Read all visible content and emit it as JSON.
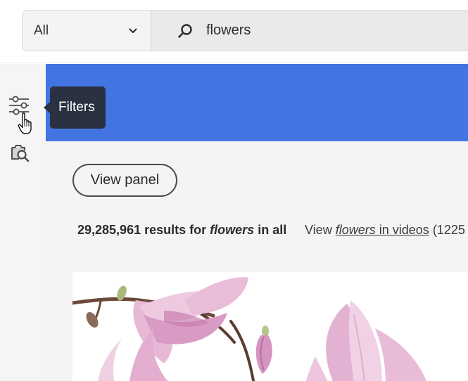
{
  "search": {
    "scope_value": "All",
    "query": "flowers"
  },
  "tooltip": {
    "label": "Filters"
  },
  "view_panel_button": {
    "label": "View panel"
  },
  "results": {
    "count": "29,285,961",
    "results_for": "results for",
    "query": "flowers",
    "scope_suffix": "in all",
    "view_prefix": "View",
    "view_query": "flowers",
    "view_link_suffix": "in videos",
    "view_count_partial": "(1225"
  },
  "colors": {
    "banner": "#4274e2",
    "tooltip_bg": "#2a3242",
    "rail_bg": "#f5f5f5",
    "content_bg": "#f4f4f4"
  },
  "icons": {
    "search": "search-icon",
    "chevron": "chevron-down-icon",
    "filters": "filters-sliders-icon",
    "visual_search": "visual-search-icon",
    "cursor": "hand-pointer-cursor"
  }
}
